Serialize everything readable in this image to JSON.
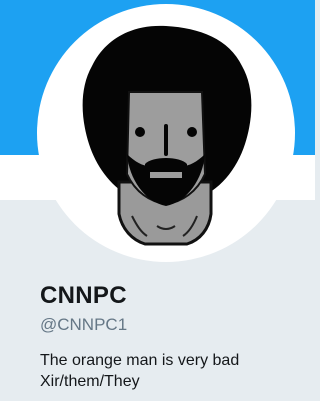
{
  "profile": {
    "display_name": "CNNPC",
    "handle": "@CNNPC1",
    "bio_lines": [
      "The orange man is very bad",
      "Xir/them/They"
    ]
  },
  "colors": {
    "header": "#1da1f2",
    "page_bg": "#e6ecf0",
    "name_text": "#14171a",
    "handle_text": "#657786"
  },
  "icons": {
    "avatar": "npc-meme-afro-avatar"
  }
}
